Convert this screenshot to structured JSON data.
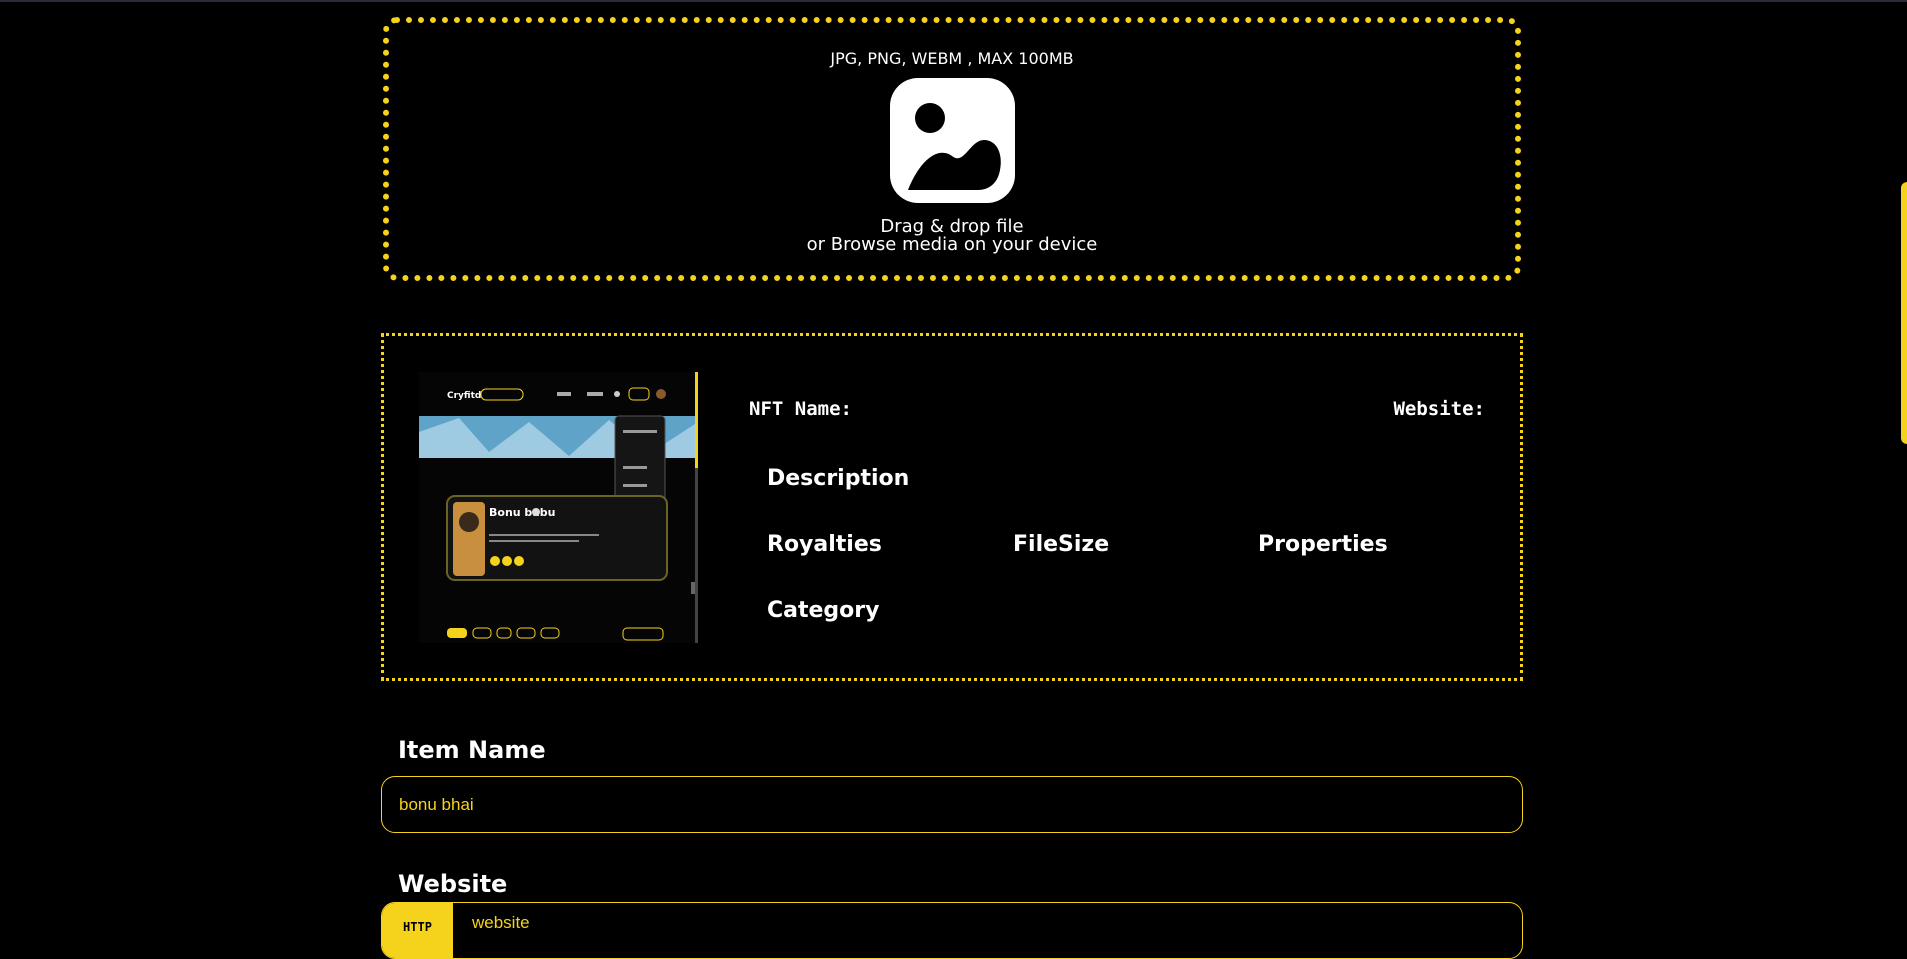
{
  "upload": {
    "formats": "JPG, PNG, WEBM , MAX 100MB",
    "drag_text": "Drag & drop file",
    "browse_text": "or Browse media on your device",
    "icon": "image-icon"
  },
  "preview": {
    "nft_name_label": "NFT Name:",
    "website_label": "Website:",
    "description_label": "Description",
    "royalties_label": "Royalties",
    "filesize_label": "FileSize",
    "properties_label": "Properties",
    "category_label": "Category",
    "thumbnail": {
      "brand": "Cryfitd",
      "profile_name": "Bonu babu"
    }
  },
  "form": {
    "item_name_label": "Item Name",
    "item_name_value": "bonu bhai",
    "website_label": "Website",
    "website_prefix": "HTTP",
    "website_value": "website"
  },
  "colors": {
    "accent": "#f5d21c",
    "background": "#000000",
    "text": "#ffffff"
  }
}
